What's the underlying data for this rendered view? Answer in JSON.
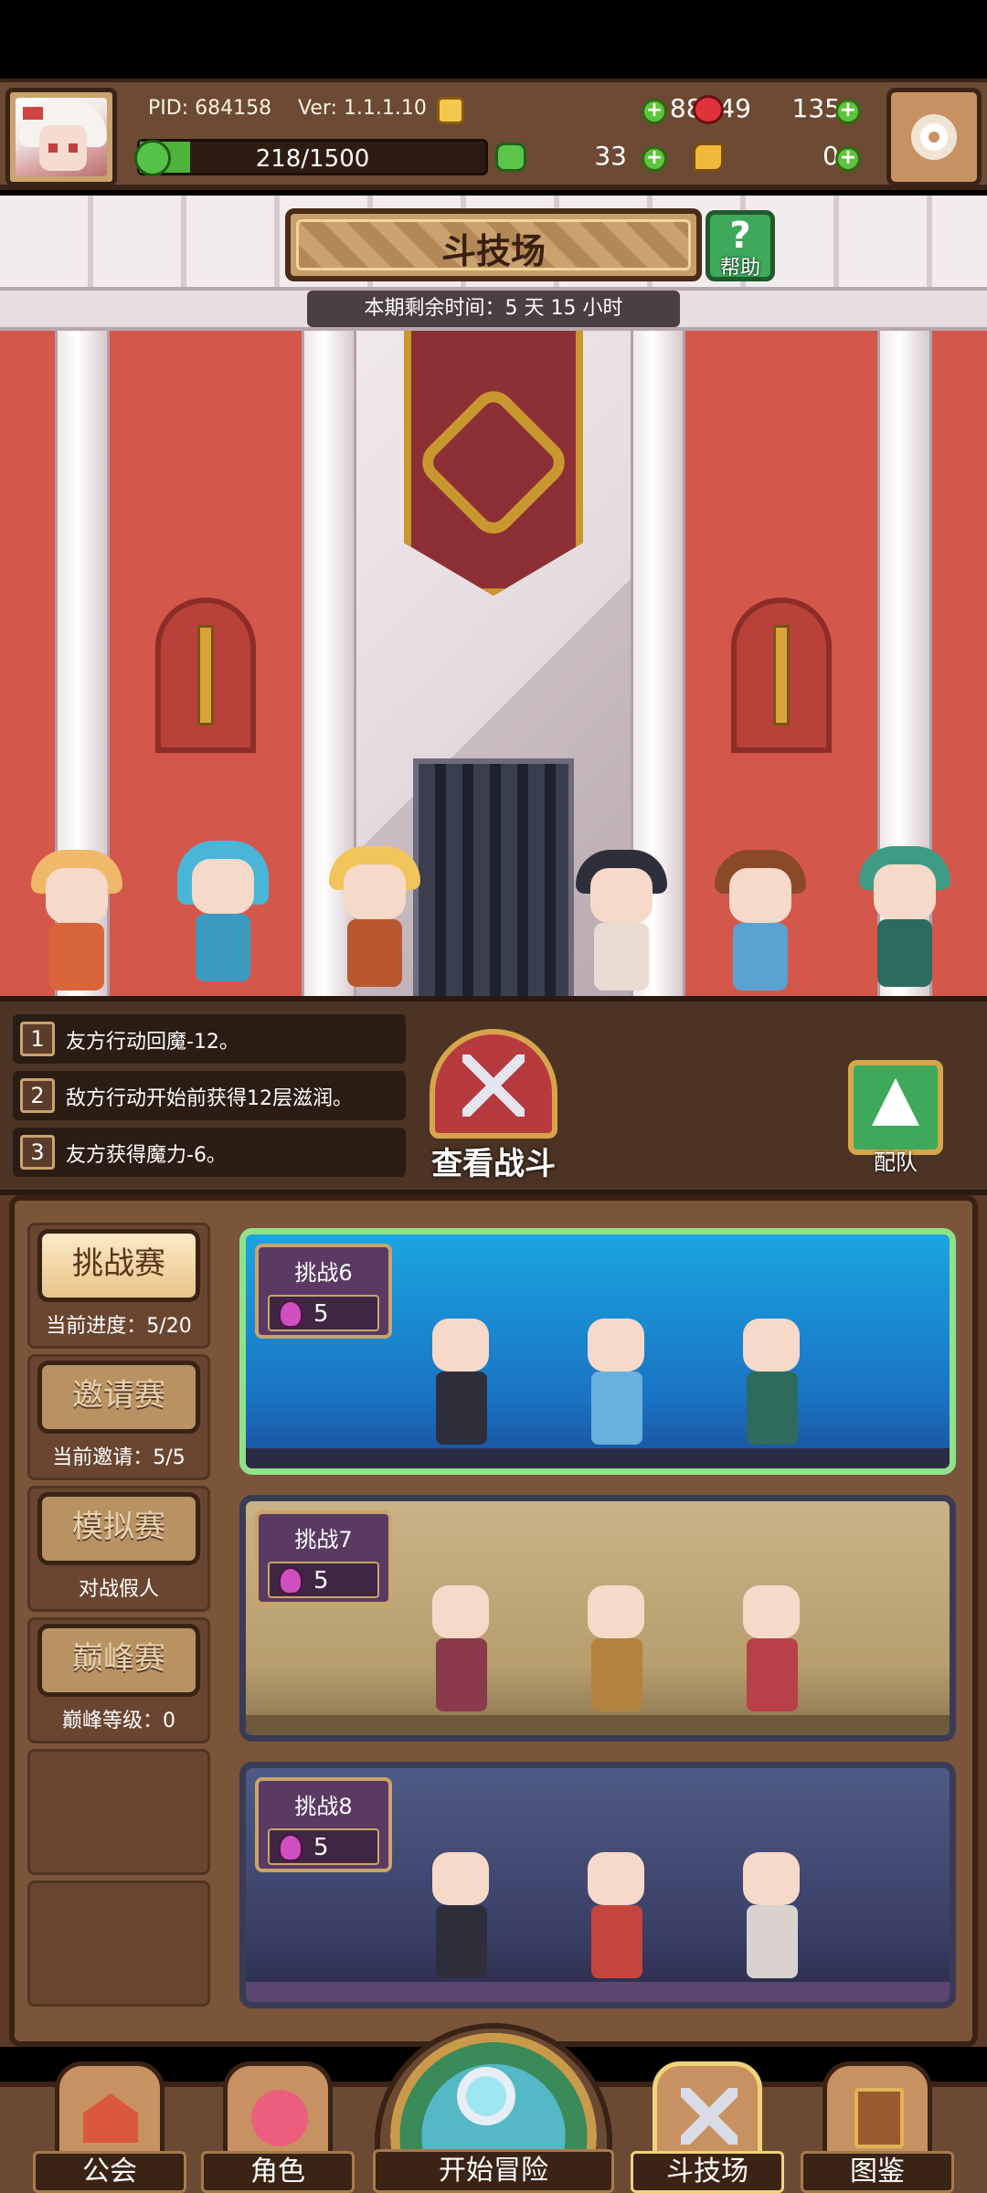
{
  "player": {
    "pid_label": "PID: 684158",
    "version_label": "Ver: 1.1.1.10",
    "gold": "88949",
    "gems": "135",
    "energy_text": "218/1500",
    "energy_progress": 0.145,
    "clovers": "33",
    "bread": "0",
    "plus_symbol": "+"
  },
  "arena": {
    "title": "斗技场",
    "help_icon_symbol": "?",
    "help_label": "帮助",
    "remaining_time": "本期剩余时间：5 天 15 小时"
  },
  "rules": [
    {
      "num": "1",
      "text": "友方行动回魔-12。"
    },
    {
      "num": "2",
      "text": "敌方行动开始前获得12层滋润。"
    },
    {
      "num": "3",
      "text": "友方获得魔力-6。"
    }
  ],
  "actions": {
    "view_battle": "查看战斗",
    "team": "配队"
  },
  "modes": [
    {
      "label": "挑战赛",
      "caption": "当前进度：5/20",
      "active": true
    },
    {
      "label": "邀请赛",
      "caption": "当前邀请：5/5",
      "active": false
    },
    {
      "label": "模拟赛",
      "caption": "对战假人",
      "active": false
    },
    {
      "label": "巅峰赛",
      "caption": "巅峰等级：0",
      "active": false
    }
  ],
  "challenges": [
    {
      "title": "挑战6",
      "cost": "5",
      "active": true
    },
    {
      "title": "挑战7",
      "cost": "5",
      "active": false
    },
    {
      "title": "挑战8",
      "cost": "5",
      "active": false
    }
  ],
  "nav": {
    "guild": "公会",
    "characters": "角色",
    "adventure": "开始冒险",
    "arena": "斗技场",
    "codex": "图鉴"
  },
  "colors": {
    "accent_green": "#5fc43c",
    "active_card_border": "#8fe28a",
    "brown_frame": "#3a2315"
  }
}
